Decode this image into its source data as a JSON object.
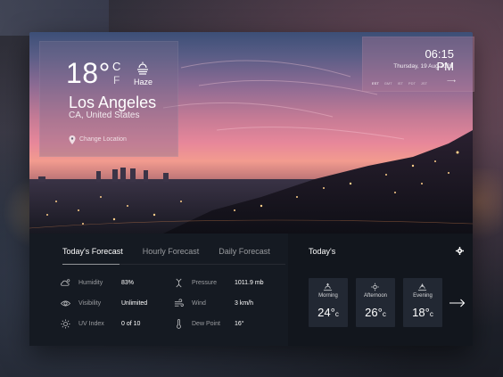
{
  "current": {
    "temperature": "18°",
    "unit_c": "C",
    "unit_f": "F",
    "condition": "Haze",
    "condition_icon": "haze-icon",
    "city": "Los Angeles",
    "region": "CA, United States",
    "change_location": "Change Location"
  },
  "clock": {
    "time": "06:15 PM",
    "date": "Thursday, 19 Aug 2021",
    "timezones": [
      "EST",
      "GMT",
      "IST",
      "PDT",
      "JST"
    ],
    "active_timezone": "EST"
  },
  "tabs": [
    {
      "label": "Today's Forecast",
      "active": true
    },
    {
      "label": "Hourly Forecast",
      "active": false
    },
    {
      "label": "Daily Forecast",
      "active": false
    }
  ],
  "metrics": [
    {
      "label": "Humidity",
      "value": "83%",
      "icon": "humidity-icon"
    },
    {
      "label": "Visibility",
      "value": "Unlimited",
      "icon": "eye-icon"
    },
    {
      "label": "UV Index",
      "value": "0 of 10",
      "icon": "sun-icon"
    },
    {
      "label": "Pressure",
      "value": "1011.9 mb",
      "icon": "pressure-icon"
    },
    {
      "label": "Wind",
      "value": "3 km/h",
      "icon": "wind-icon"
    },
    {
      "label": "Dew Point",
      "value": "16°",
      "icon": "thermometer-icon"
    }
  ],
  "today": {
    "title": "Today's",
    "periods": [
      {
        "label": "Morning",
        "temp": "24°",
        "unit": "c",
        "icon": "sunrise-icon"
      },
      {
        "label": "Afternoon",
        "temp": "26°",
        "unit": "c",
        "icon": "sun-icon"
      },
      {
        "label": "Evening",
        "temp": "18°",
        "unit": "c",
        "icon": "sunset-icon"
      }
    ]
  },
  "colors": {
    "panel_bg": "#151a22",
    "card_bg": "#222833",
    "sky_pink": "#e7879a"
  }
}
